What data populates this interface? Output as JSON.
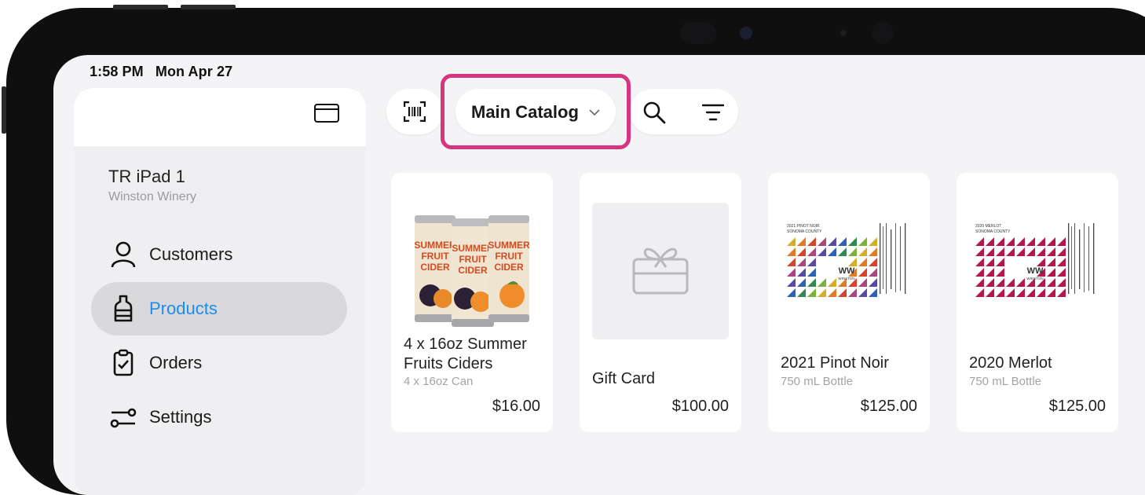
{
  "status_bar": {
    "time": "1:58 PM",
    "date": "Mon Apr 27"
  },
  "sidebar": {
    "device_name": "TR iPad 1",
    "location": "Winston Winery",
    "items": [
      {
        "label": "Customers",
        "icon": "person-icon",
        "active": false
      },
      {
        "label": "Products",
        "icon": "bottle-icon",
        "active": true
      },
      {
        "label": "Orders",
        "icon": "clipboard-icon",
        "active": false
      },
      {
        "label": "Settings",
        "icon": "sliders-icon",
        "active": false
      }
    ]
  },
  "toolbar": {
    "catalog_label": "Main Catalog",
    "highlight_color": "#d6357f"
  },
  "products": [
    {
      "name": "4 x 16oz Summer Fruits Ciders",
      "subtitle": "4 x 16oz Can",
      "price": "$16.00",
      "can_text": "SUMMER FRUIT CIDER"
    },
    {
      "name": "Gift Card",
      "subtitle": "",
      "price": "$100.00"
    },
    {
      "name": "2021 Pinot Noir",
      "subtitle": "750 mL Bottle",
      "price": "$125.00",
      "label_title": "2021 PINOT NOIR",
      "label_region": "SONOMA COUNTY",
      "brand": "WINSTON"
    },
    {
      "name": "2020 Merlot",
      "subtitle": "750 mL Bottle",
      "price": "$125.00",
      "label_title": "2020 MERLOT",
      "label_region": "SONOMA COUNTY",
      "brand": "WINSTON"
    }
  ],
  "colors": {
    "accent": "#1c8cf0",
    "active_nav_bg": "#d9d9dc",
    "merlot": "#b5174b"
  }
}
